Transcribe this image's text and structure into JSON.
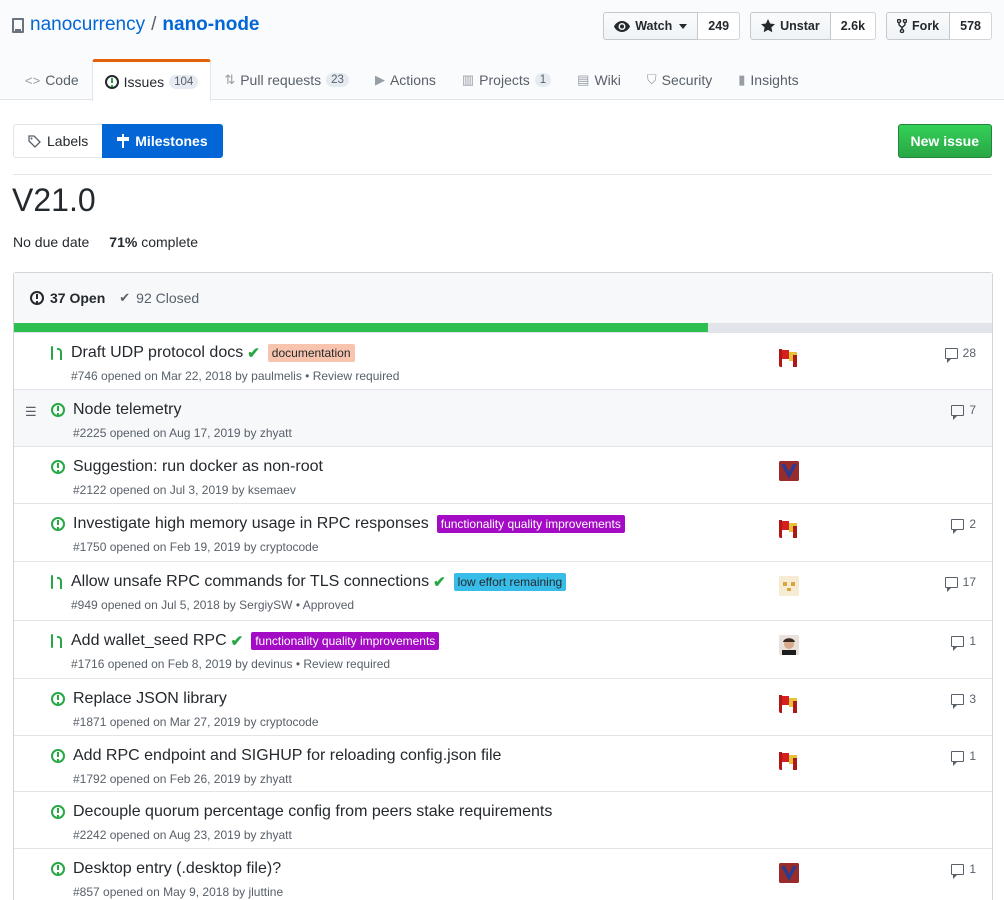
{
  "repo": {
    "owner": "nanocurrency",
    "separator": "/",
    "name": "nano-node"
  },
  "actions": [
    {
      "label": "Watch",
      "icon": "eye-icon",
      "count": "249",
      "has_caret": true
    },
    {
      "label": "Unstar",
      "icon": "star-icon",
      "count": "2.6k"
    },
    {
      "label": "Fork",
      "icon": "fork-icon",
      "count": "578"
    }
  ],
  "nav": [
    {
      "label": "Code",
      "icon": "code-icon"
    },
    {
      "label": "Issues",
      "icon": "issue-icon",
      "counter": "104",
      "selected": true
    },
    {
      "label": "Pull requests",
      "icon": "pull-request-icon",
      "counter": "23"
    },
    {
      "label": "Actions",
      "icon": "play-icon"
    },
    {
      "label": "Projects",
      "icon": "project-icon",
      "counter": "1"
    },
    {
      "label": "Wiki",
      "icon": "book-icon"
    },
    {
      "label": "Security",
      "icon": "shield-icon"
    },
    {
      "label": "Insights",
      "icon": "graph-icon"
    }
  ],
  "subnav": {
    "labels": "Labels",
    "milestones": "Milestones"
  },
  "new_issue": "New issue",
  "milestone": {
    "title": "V21.0",
    "due": "No due date",
    "percent": "71%",
    "complete": "complete",
    "progress": 0.71
  },
  "summary": {
    "open": "37 Open",
    "closed": "92 Closed"
  },
  "issues": [
    {
      "type": "pr",
      "title": "Draft UDP protocol docs",
      "check": true,
      "label": "documentation",
      "label_bg": "#f8c4ad",
      "label_fg": "#24292e",
      "meta": "#746 opened on Mar 22, 2018 by paulmelis • Review required",
      "avatar": "flag",
      "comments": "28"
    },
    {
      "type": "issue",
      "title": "Node telemetry",
      "meta": "#2225 opened on Aug 17, 2019 by zhyatt",
      "avatar": "",
      "comments": "7",
      "highlight": true
    },
    {
      "type": "issue",
      "title": "Suggestion: run docker as non-root",
      "meta": "#2122 opened on Jul 3, 2019 by ksemaev",
      "avatar": "v",
      "comments": ""
    },
    {
      "type": "issue",
      "title": "Investigate high memory usage in RPC responses",
      "label": "functionality quality improvements",
      "label_bg": "#a30bc4",
      "label_fg": "#ffffff",
      "meta": "#1750 opened on Feb 19, 2019 by cryptocode",
      "avatar": "flag",
      "comments": "2"
    },
    {
      "type": "pr",
      "title": "Allow unsafe RPC commands for TLS connections",
      "check": true,
      "label": "low effort remaining",
      "label_bg": "#38bde8",
      "label_fg": "#24292e",
      "meta": "#949 opened on Jul 5, 2018 by SergiySW • Approved",
      "avatar": "yellow",
      "comments": "17"
    },
    {
      "type": "pr",
      "title": "Add wallet_seed RPC",
      "check": true,
      "label": "functionality quality improvements",
      "label_bg": "#a30bc4",
      "label_fg": "#ffffff",
      "meta": "#1716 opened on Feb 8, 2019 by devinus • Review required",
      "avatar": "face",
      "comments": "1"
    },
    {
      "type": "issue",
      "title": "Replace JSON library",
      "meta": "#1871 opened on Mar 27, 2019 by cryptocode",
      "avatar": "flag",
      "comments": "3"
    },
    {
      "type": "issue",
      "title": "Add RPC endpoint and SIGHUP for reloading config.json file",
      "meta": "#1792 opened on Feb 26, 2019 by zhyatt",
      "avatar": "flag",
      "comments": "1"
    },
    {
      "type": "issue",
      "title": "Decouple quorum percentage config from peers stake requirements",
      "meta": "#2242 opened on Aug 23, 2019 by zhyatt",
      "avatar": "",
      "comments": ""
    },
    {
      "type": "issue",
      "title": "Desktop entry (.desktop file)?",
      "meta": "#857 opened on May 9, 2018 by jluttine",
      "avatar": "v",
      "comments": "1"
    }
  ]
}
